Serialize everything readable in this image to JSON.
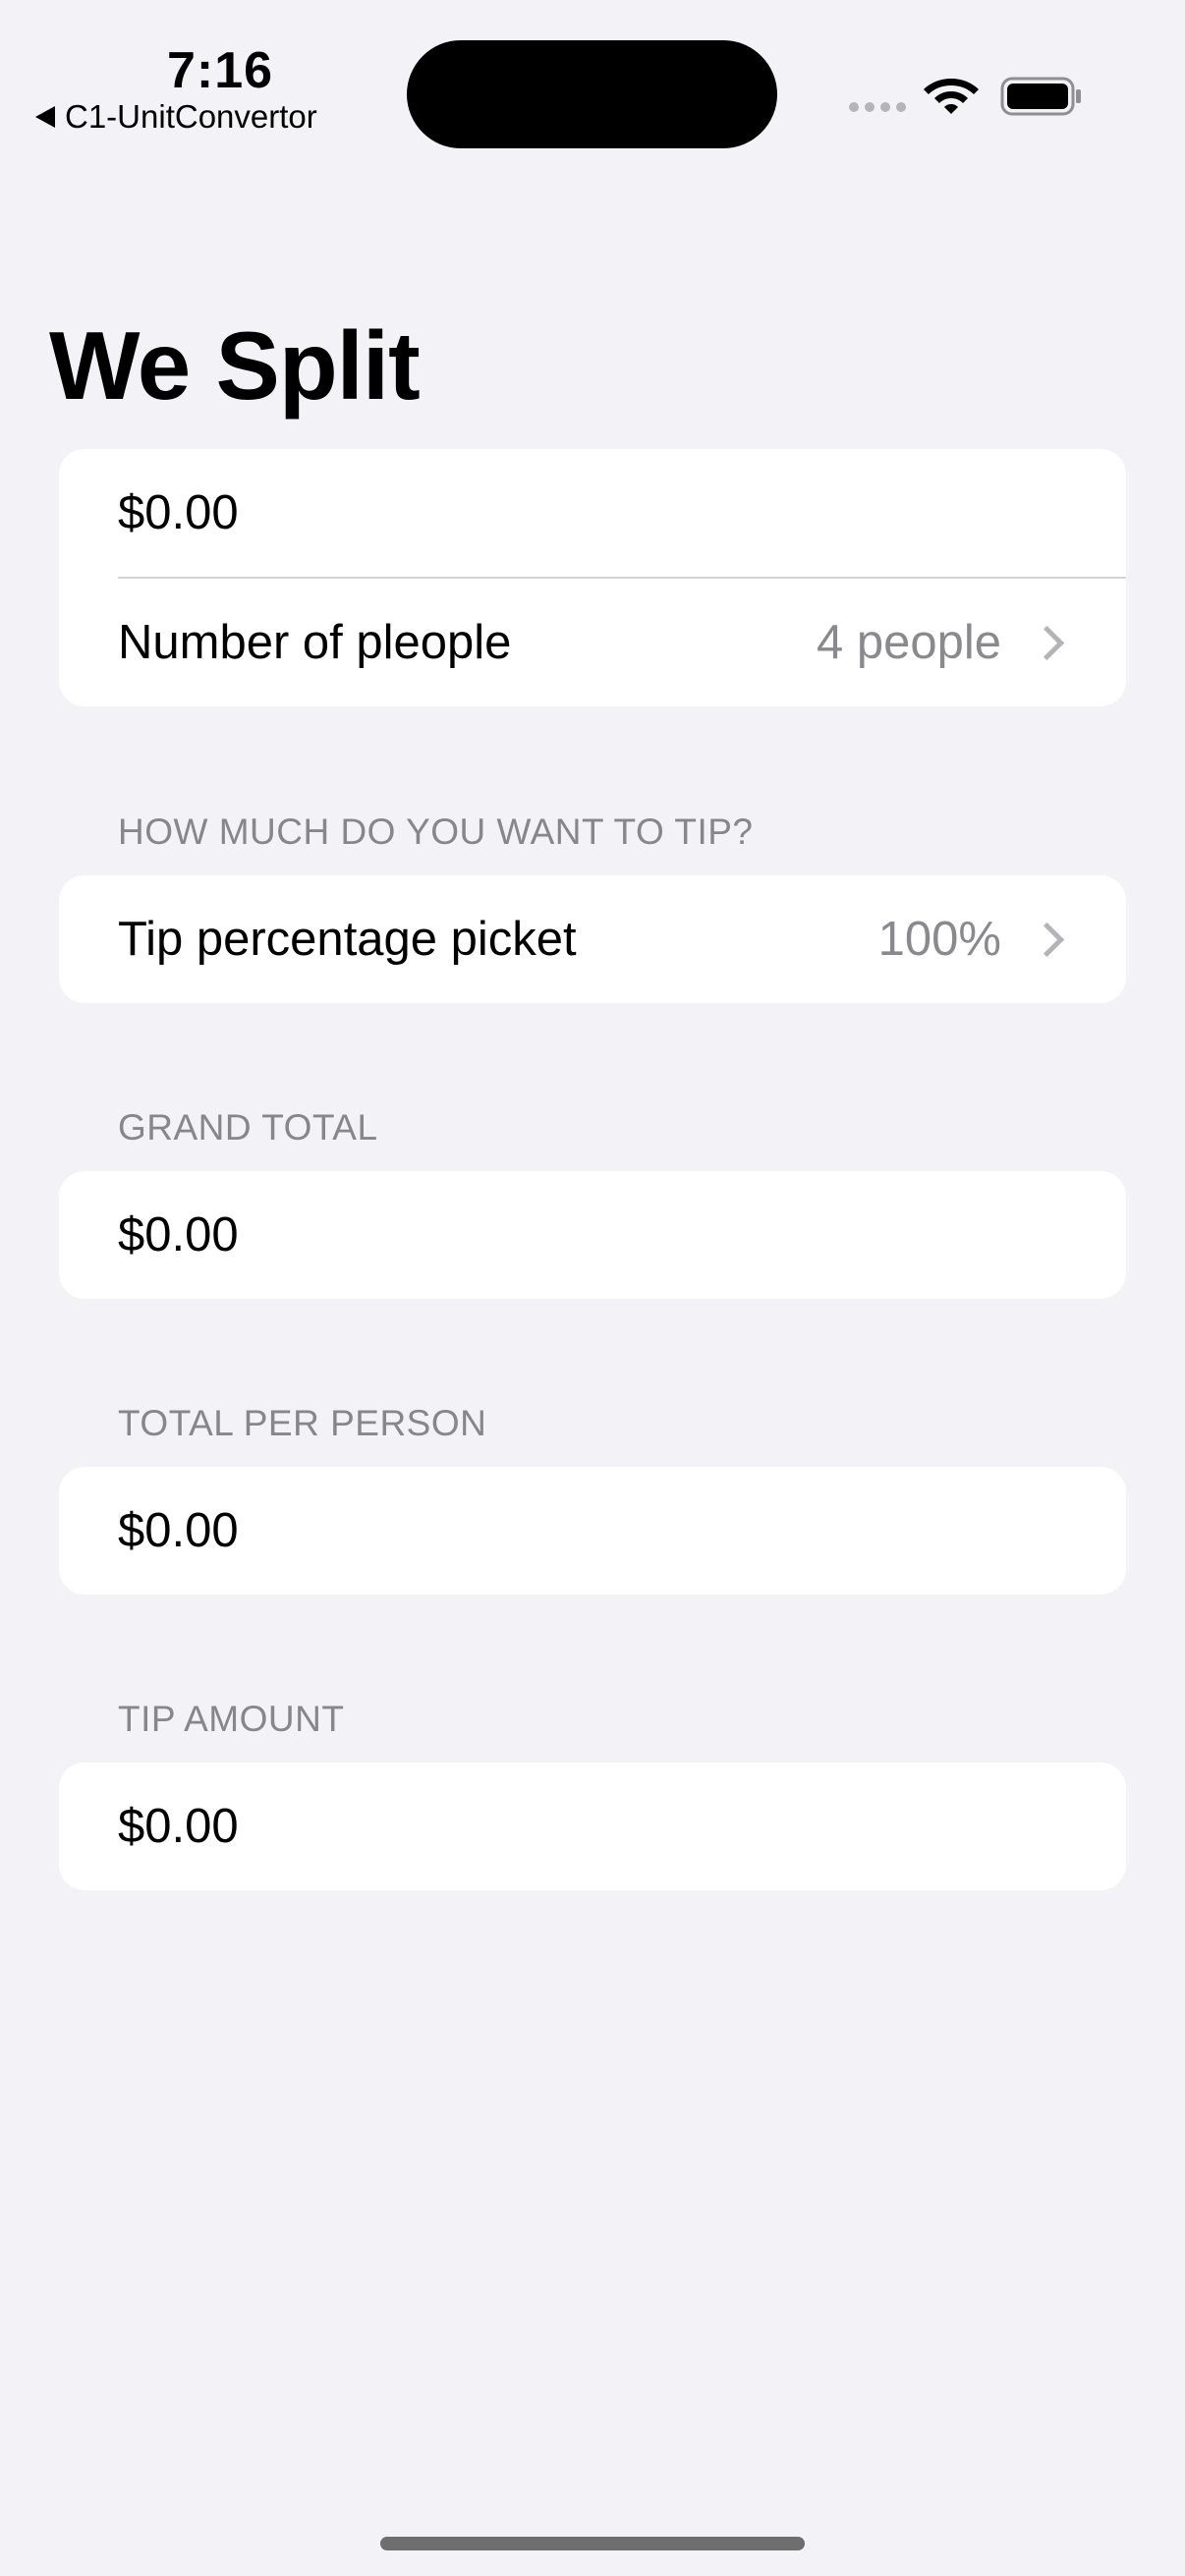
{
  "status_bar": {
    "time": "7:16",
    "back_app": "C1-UnitConvertor"
  },
  "page": {
    "title": "We Split"
  },
  "input_section": {
    "amount_value": "$0.00",
    "people_label": "Number of pleople",
    "people_value": "4 people"
  },
  "tip_section": {
    "header": "HOW MUCH DO YOU WANT TO TIP?",
    "label": "Tip percentage picket",
    "value": "100%"
  },
  "grand_total_section": {
    "header": "GRAND TOTAL",
    "value": "$0.00"
  },
  "per_person_section": {
    "header": "TOTAL PER PERSON",
    "value": "$0.00"
  },
  "tip_amount_section": {
    "header": "TIP AMOUNT",
    "value": "$0.00"
  },
  "colors": {
    "background": "#f2f2f7",
    "card": "#ffffff",
    "secondary_text": "#8a8a8e"
  },
  "icons": [
    "back-arrow-icon",
    "cellular-icon",
    "wifi-icon",
    "battery-icon",
    "chevron-right-icon"
  ]
}
